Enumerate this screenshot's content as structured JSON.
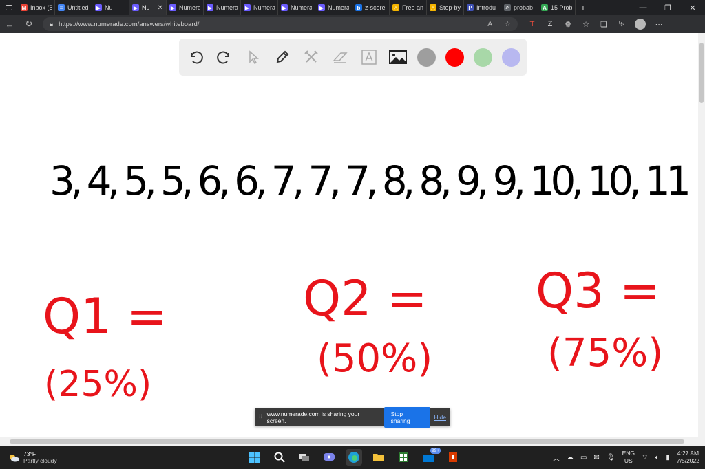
{
  "browser": {
    "tabs": [
      {
        "label": "Inbox (5",
        "icon": "gmail-icon",
        "color": "#ea4335",
        "glyph": "M"
      },
      {
        "label": "Untitled",
        "icon": "docs-icon",
        "color": "#4285f4",
        "glyph": "≡"
      },
      {
        "label": "Nu",
        "icon": "numerade-icon",
        "color": "#6b5cff",
        "glyph": "▶"
      },
      {
        "label": "Nu",
        "icon": "numerade-icon",
        "color": "#6b5cff",
        "glyph": "▶",
        "active": true
      },
      {
        "label": "Numera",
        "icon": "numerade-icon",
        "color": "#6b5cff",
        "glyph": "▶"
      },
      {
        "label": "Numera",
        "icon": "numerade-icon",
        "color": "#6b5cff",
        "glyph": "▶"
      },
      {
        "label": "Numera",
        "icon": "numerade-icon",
        "color": "#6b5cff",
        "glyph": "▶"
      },
      {
        "label": "Numera",
        "icon": "numerade-icon",
        "color": "#6b5cff",
        "glyph": "▶"
      },
      {
        "label": "Numera",
        "icon": "numerade-icon",
        "color": "#6b5cff",
        "glyph": "▶"
      },
      {
        "label": "z-score",
        "icon": "bing-icon",
        "color": "#1a73e8",
        "glyph": "b"
      },
      {
        "label": "Free and",
        "icon": "delta-icon",
        "color": "#f4b400",
        "glyph": "△"
      },
      {
        "label": "Step-by",
        "icon": "delta-icon",
        "color": "#f4b400",
        "glyph": "△"
      },
      {
        "label": "Introdu",
        "icon": "p-icon",
        "color": "#3f51b5",
        "glyph": "P"
      },
      {
        "label": "probab",
        "icon": "search-icon",
        "color": "#5f6368",
        "glyph": "⌕"
      },
      {
        "label": "15 Prob",
        "icon": "sheet-icon",
        "color": "#34a853",
        "glyph": "A"
      }
    ],
    "url": "https://www.numerade.com/answers/whiteboard/"
  },
  "whiteboard": {
    "tools": [
      "undo-icon",
      "redo-icon",
      "pointer-icon",
      "pen-icon",
      "tools-icon",
      "eraser-icon",
      "text-icon",
      "image-icon"
    ],
    "colors": [
      "#9e9e9e",
      "#ff0000",
      "#a8d8a8",
      "#b8b8f0"
    ],
    "ink_color_numbers": "#000000",
    "ink_color_quartiles": "#e8141b",
    "handwriting": {
      "data_list": "3, 4, 5, 5, 6, 6, 7, 7, 7, 8, 8, 9, 9, 10, 10, 11",
      "q1": "Q1 =",
      "q1_pct": "(25%)",
      "q2": "Q2 =",
      "q2_pct": "(50%)",
      "q3": "Q3 =",
      "q3_pct": "(75%)"
    }
  },
  "share": {
    "message": "www.numerade.com is sharing your screen.",
    "stop_label": "Stop sharing",
    "hide_label": "Hide"
  },
  "taskbar": {
    "weather_temp": "73°F",
    "weather_desc": "Partly cloudy",
    "lang_top": "ENG",
    "lang_bottom": "US",
    "time": "4:27 AM",
    "date": "7/5/2022",
    "badge": "99+"
  }
}
